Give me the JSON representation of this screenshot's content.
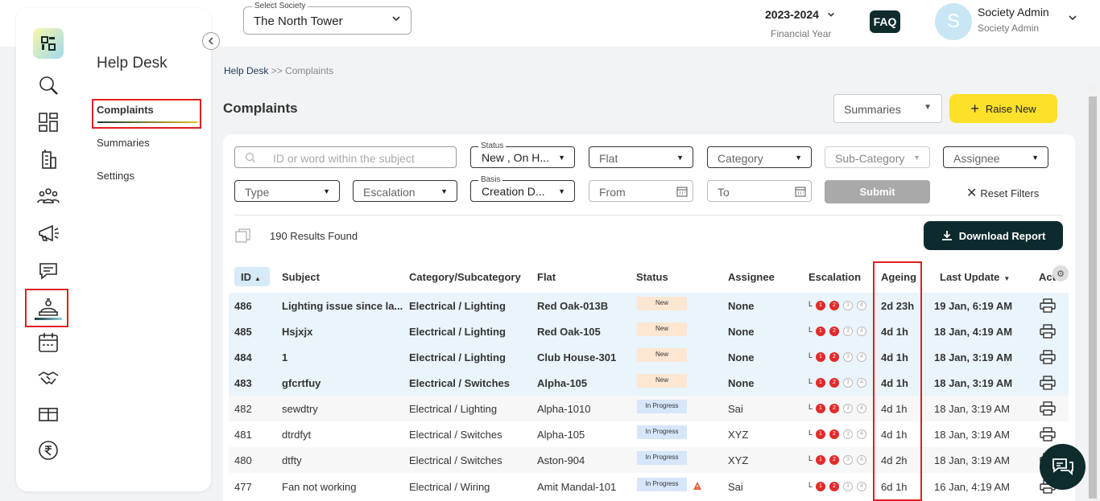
{
  "top": {
    "society_label": "Select Society",
    "society_value": "The North Tower",
    "financial_year": "2023-2024",
    "financial_year_label": "Financial Year",
    "faq": "FAQ",
    "avatar_letter": "S",
    "user_name": "Society Admin",
    "user_role": "Society Admin"
  },
  "sidebar": {
    "section_title": "Help Desk",
    "items": [
      {
        "label": "Complaints",
        "active": true
      },
      {
        "label": "Summaries",
        "active": false
      },
      {
        "label": "Settings",
        "active": false
      }
    ],
    "rail_icons": [
      "search-icon",
      "dashboard-icon",
      "building-icon",
      "residents-icon",
      "announcement-icon",
      "chat-icon",
      "helpdesk-icon",
      "calendar-icon",
      "handshake-icon",
      "amenities-icon",
      "rupee-icon"
    ]
  },
  "breadcrumb": {
    "root": "Help Desk",
    "sep": ">>",
    "current": "Complaints"
  },
  "page_title": "Complaints",
  "summaries_select": "Summaries",
  "raise_new": "Raise New",
  "filters": {
    "search_placeholder": "ID or word within the subject",
    "status_label": "Status",
    "status_value": "New , On H...",
    "flat": "Flat",
    "category": "Category",
    "sub_category": "Sub-Category",
    "assignee": "Assignee",
    "type": "Type",
    "escalation": "Escalation",
    "basis_label": "Basis",
    "basis_value": "Creation D...",
    "from": "From",
    "to": "To",
    "submit": "Submit",
    "reset": "Reset Filters"
  },
  "results": "190 Results Found",
  "download_report": "Download Report",
  "table": {
    "columns": [
      "ID",
      "Subject",
      "Category/Subcategory",
      "Flat",
      "Status",
      "Assignee",
      "Escalation",
      "Ageing",
      "Last Update",
      "Act"
    ],
    "rows": [
      {
        "id": "486",
        "subject": "Lighting issue since la...",
        "category": "Electrical / Lighting",
        "flat": "Red Oak-013B",
        "status": "New",
        "assignee": "None",
        "esc": "L",
        "ageing": "2d 23h",
        "update": "19 Jan, 6:19 AM",
        "bold": true,
        "warn": false
      },
      {
        "id": "485",
        "subject": "Hsjxjx",
        "category": "Electrical / Lighting",
        "flat": "Red Oak-105",
        "status": "New",
        "assignee": "None",
        "esc": "L",
        "ageing": "4d 1h",
        "update": "18 Jan, 4:19 AM",
        "bold": true,
        "warn": false
      },
      {
        "id": "484",
        "subject": "1",
        "category": "Electrical / Lighting",
        "flat": "Club House-301",
        "status": "New",
        "assignee": "None",
        "esc": "L",
        "ageing": "4d 1h",
        "update": "18 Jan, 3:19 AM",
        "bold": true,
        "warn": false
      },
      {
        "id": "483",
        "subject": "gfcrtfuy",
        "category": "Electrical / Switches",
        "flat": "Alpha-105",
        "status": "New",
        "assignee": "None",
        "esc": "L",
        "ageing": "4d 1h",
        "update": "18 Jan, 3:19 AM",
        "bold": true,
        "warn": false
      },
      {
        "id": "482",
        "subject": "sewdtry",
        "category": "Electrical / Lighting",
        "flat": "Alpha-1010",
        "status": "In Progress",
        "assignee": "Sai",
        "esc": "L",
        "ageing": "4d 1h",
        "update": "18 Jan, 3:19 AM",
        "bold": false,
        "warn": false
      },
      {
        "id": "481",
        "subject": "dtrdfyt",
        "category": "Electrical / Switches",
        "flat": "Alpha-105",
        "status": "In Progress",
        "assignee": "XYZ",
        "esc": "L",
        "ageing": "4d 1h",
        "update": "18 Jan, 3:19 AM",
        "bold": false,
        "warn": false
      },
      {
        "id": "480",
        "subject": "dtfty",
        "category": "Electrical / Switches",
        "flat": "Aston-904",
        "status": "In Progress",
        "assignee": "XYZ",
        "esc": "L",
        "ageing": "4d 2h",
        "update": "18 Jan, 3:19 AM",
        "bold": false,
        "warn": false
      },
      {
        "id": "477",
        "subject": "Fan not working",
        "category": "Electrical / Wiring",
        "flat": "Amit Mandal-101",
        "status": "In Progress",
        "assignee": "Sai",
        "esc": "L",
        "ageing": "6d 1h",
        "update": "16 Jan, 4:19 AM",
        "bold": false,
        "warn": true
      }
    ],
    "escalation_levels": [
      "1",
      "2",
      "3",
      "4"
    ]
  },
  "colors": {
    "accent_yellow": "#fde02a",
    "dark_teal": "#0d2b2f",
    "highlight_red": "#e02020",
    "row_blue": "#eaf4fb"
  }
}
